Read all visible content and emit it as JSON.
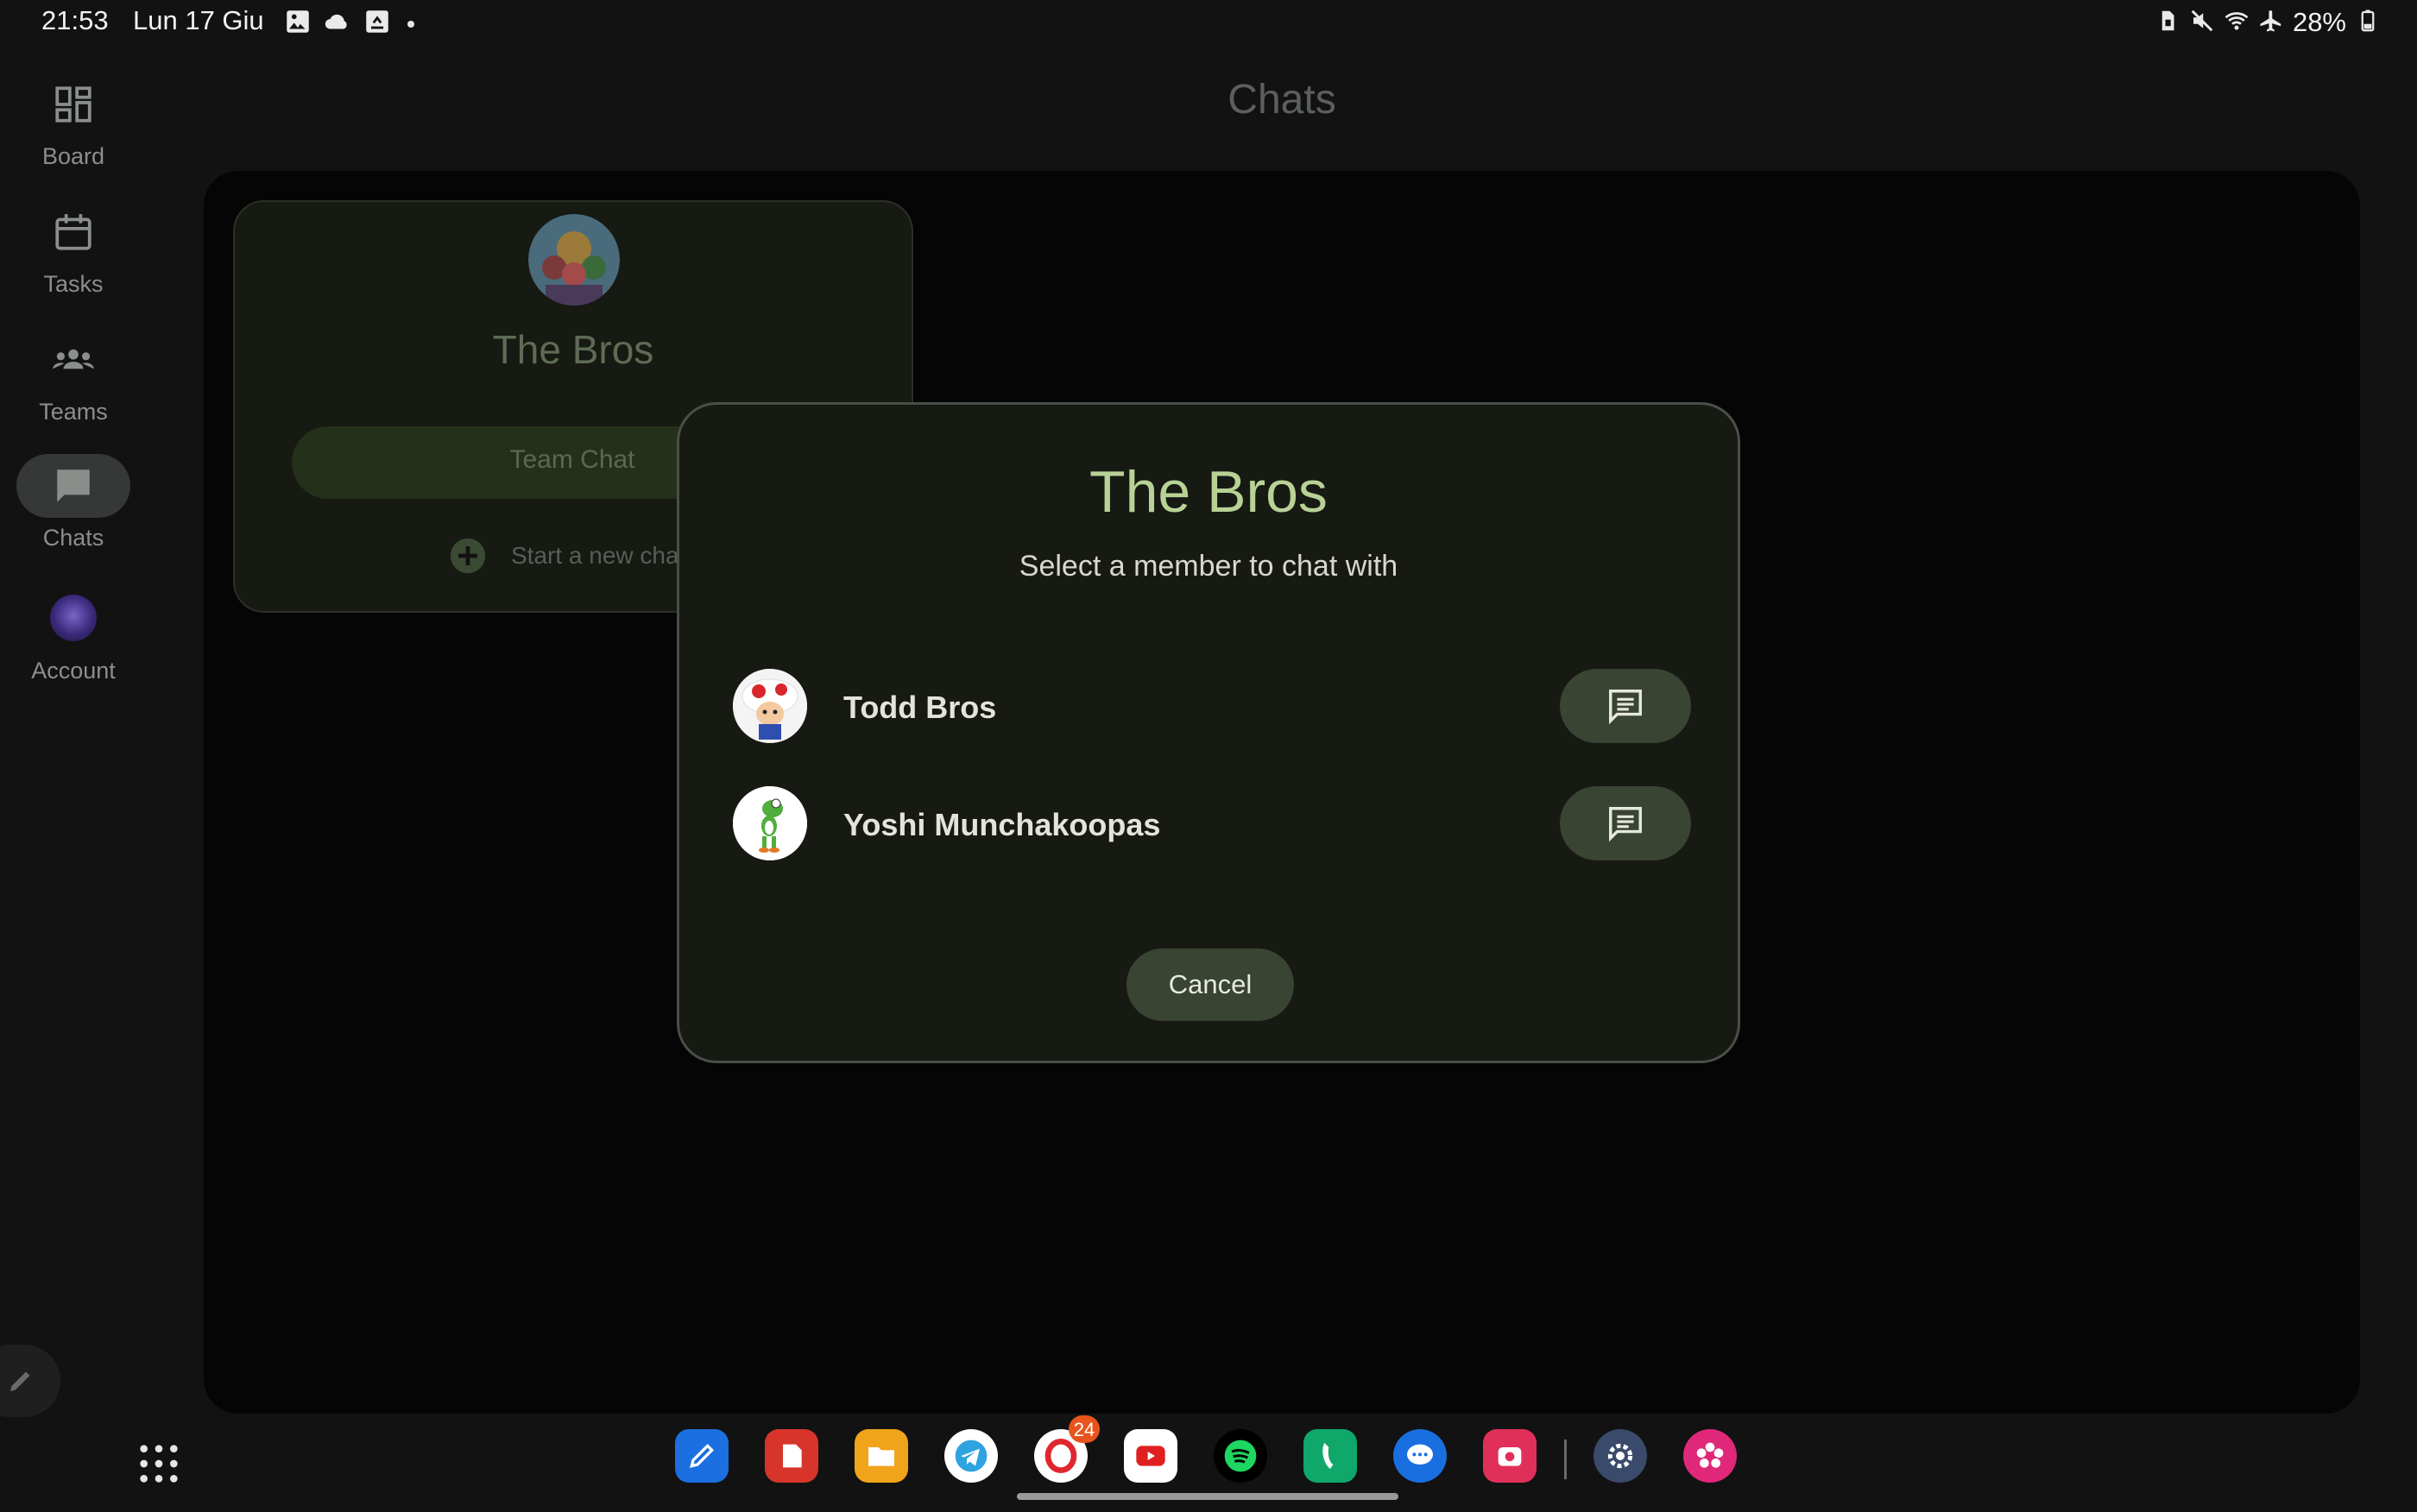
{
  "status_bar": {
    "time": "21:53",
    "date": "Lun 17 Giu",
    "battery": "28%",
    "notification_icons": [
      "gallery-icon",
      "cloud-icon",
      "screenshot-icon"
    ],
    "system_icons": [
      "sim-icon",
      "mute-icon",
      "wifi-icon",
      "airplane-icon",
      "battery-icon"
    ]
  },
  "rail": {
    "items": [
      {
        "label": "Board",
        "icon": "board-icon"
      },
      {
        "label": "Tasks",
        "icon": "calendar-icon"
      },
      {
        "label": "Teams",
        "icon": "teams-icon"
      },
      {
        "label": "Chats",
        "icon": "chat-icon",
        "active": true
      },
      {
        "label": "Account",
        "icon": "account-avatar"
      }
    ]
  },
  "page": {
    "title": "Chats"
  },
  "team_card": {
    "name": "The Bros",
    "team_chat_label": "Team Chat",
    "new_chat_label": "Start a new chat"
  },
  "dialog": {
    "title": "The Bros",
    "subtitle": "Select a member to chat with",
    "members": [
      {
        "name": "Todd Bros",
        "avatar": "toad-avatar"
      },
      {
        "name": "Yoshi Munchakoopas",
        "avatar": "yoshi-avatar"
      }
    ],
    "cancel_label": "Cancel"
  },
  "dock": {
    "badge_count": "24",
    "apps": [
      "notes-app",
      "acrobat-app",
      "files-app",
      "telegram-app",
      "opera-app",
      "youtube-app",
      "spotify-app",
      "phone-app",
      "messages-app",
      "camera-app",
      "settings-app",
      "blossom-app"
    ]
  },
  "colors": {
    "dialog_title": "#b8d296",
    "button_bg": "#3a4433",
    "background": "#121212"
  }
}
